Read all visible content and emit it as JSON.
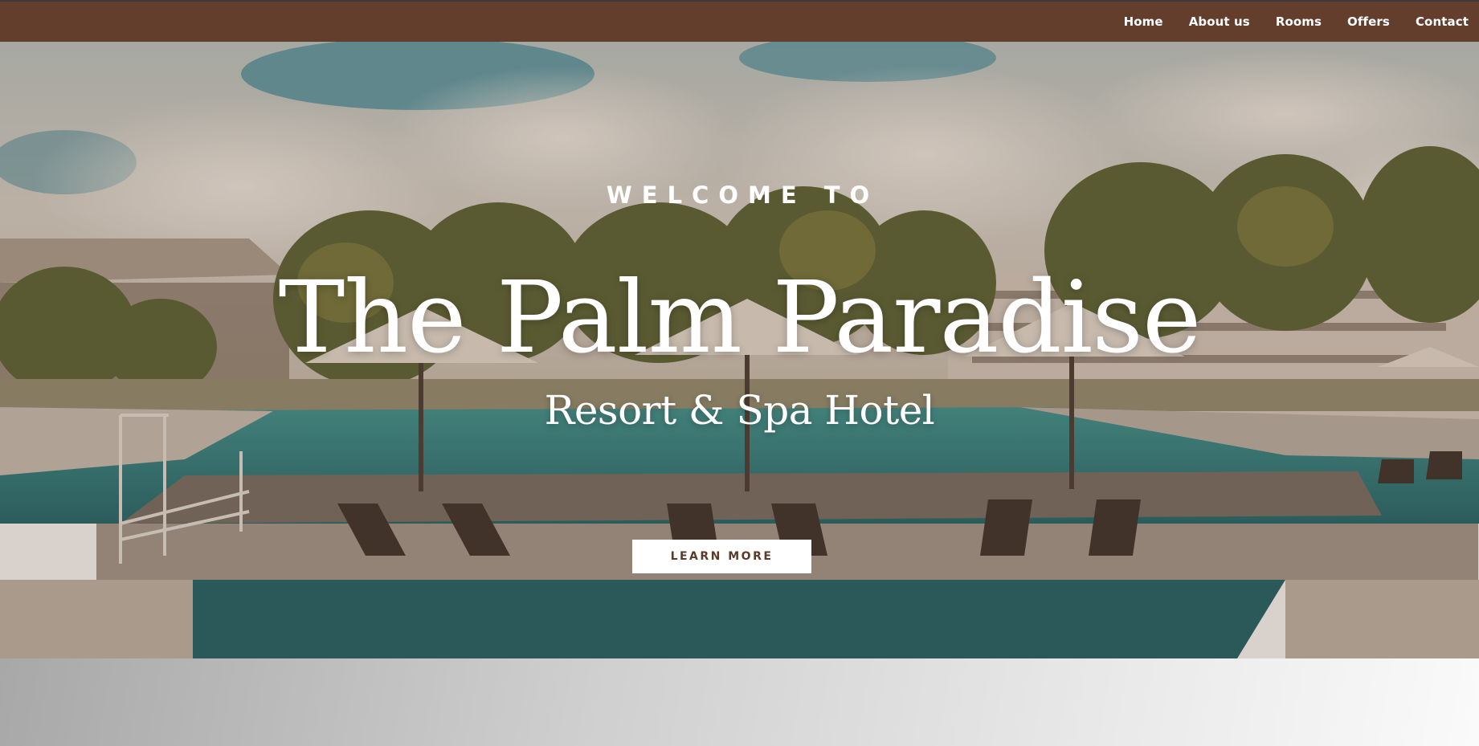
{
  "nav": {
    "items": [
      {
        "label": "Home"
      },
      {
        "label": "About us"
      },
      {
        "label": "Rooms"
      },
      {
        "label": "Offers"
      },
      {
        "label": "Contact"
      }
    ]
  },
  "hero": {
    "eyebrow": "WELCOME TO",
    "title": "The Palm Paradise",
    "subtitle": "Resort & Spa Hotel",
    "cta_label": "LEARN MORE"
  },
  "colors": {
    "nav_background": "#633e2c",
    "cta_text": "#5a3a29",
    "pool_water": "#1e8c8c"
  }
}
